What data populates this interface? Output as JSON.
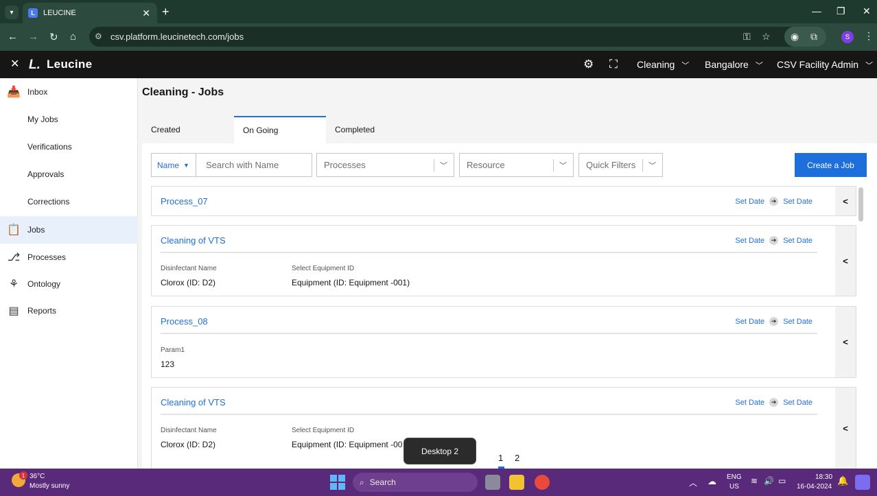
{
  "browser": {
    "tab_title": "LEUCINE",
    "tab_favicon": "L",
    "url": "csv.platform.leucinetech.com/jobs",
    "profile_initial": "S",
    "icons": [
      "tab-search-icon",
      "close-icon",
      "new-tab-icon",
      "minimize-icon",
      "maximize-icon",
      "window-close-icon",
      "back-icon",
      "forward-icon",
      "reload-icon",
      "home-icon",
      "site-settings-icon",
      "password-key-icon",
      "bookmark-star-icon",
      "screenshot-icon",
      "extensions-icon",
      "menu-kebab-icon"
    ]
  },
  "header": {
    "logo_mark": "L.",
    "logo_text": "Leucine",
    "use_case": "Cleaning",
    "facility": "Bangalore",
    "user": "CSV Facility Admin",
    "icons": [
      "close-icon",
      "gear-icon",
      "scan-icon",
      "chevron-down-icon"
    ]
  },
  "sidebar": {
    "items": [
      {
        "label": "Inbox",
        "icon": "inbox-icon"
      },
      {
        "label": "My Jobs"
      },
      {
        "label": "Verifications"
      },
      {
        "label": "Approvals"
      },
      {
        "label": "Corrections"
      },
      {
        "label": "Jobs",
        "icon": "clipboard-icon",
        "active": true
      },
      {
        "label": "Processes",
        "icon": "process-flow-icon"
      },
      {
        "label": "Ontology",
        "icon": "hierarchy-icon"
      },
      {
        "label": "Reports",
        "icon": "report-icon"
      }
    ]
  },
  "main": {
    "title": "Cleaning - Jobs",
    "tabs": [
      {
        "label": "Created"
      },
      {
        "label": "On Going",
        "active": true
      },
      {
        "label": "Completed"
      }
    ],
    "filters": {
      "name_select": "Name",
      "search_placeholder": "Search with Name",
      "processes_placeholder": "Processes",
      "resource_placeholder": "Resource",
      "quick_filters_placeholder": "Quick Filters"
    },
    "create_button": "Create a Job",
    "jobs": [
      {
        "title": "Process_07",
        "start": "Set Date",
        "end": "Set Date",
        "params": []
      },
      {
        "title": "Cleaning of VTS",
        "start": "Set Date",
        "end": "Set Date",
        "params": [
          {
            "label": "Disinfectant Name",
            "value": "Clorox (ID: D2)"
          },
          {
            "label": "Select Equipment ID",
            "value": "Equipment (ID: Equipment -001)"
          }
        ]
      },
      {
        "title": "Process_08",
        "start": "Set Date",
        "end": "Set Date",
        "params": [
          {
            "label": "Param1",
            "value": "123"
          }
        ]
      },
      {
        "title": "Cleaning of VTS",
        "start": "Set Date",
        "end": "Set Date",
        "params": [
          {
            "label": "Disinfectant Name",
            "value": "Clorox (ID: D2)"
          },
          {
            "label": "Select Equipment ID",
            "value": "Equipment (ID: Equipment -00"
          }
        ]
      }
    ],
    "pages": [
      "1",
      "2"
    ],
    "current_page": "1"
  },
  "desktop_tooltip": "Desktop 2",
  "taskbar": {
    "weather_badge": "1",
    "temperature": "36°C",
    "weather": "Mostly sunny",
    "search_label": "Search",
    "language": "ENG",
    "region": "US",
    "time": "18:30",
    "date": "16-04-2024"
  },
  "colors": {
    "accent": "#1d6fdb",
    "appbar": "#161616",
    "browser_frame": "#1e3a2f",
    "taskbar": "#5a2a7a",
    "active_nav": "#e8f0fc"
  }
}
